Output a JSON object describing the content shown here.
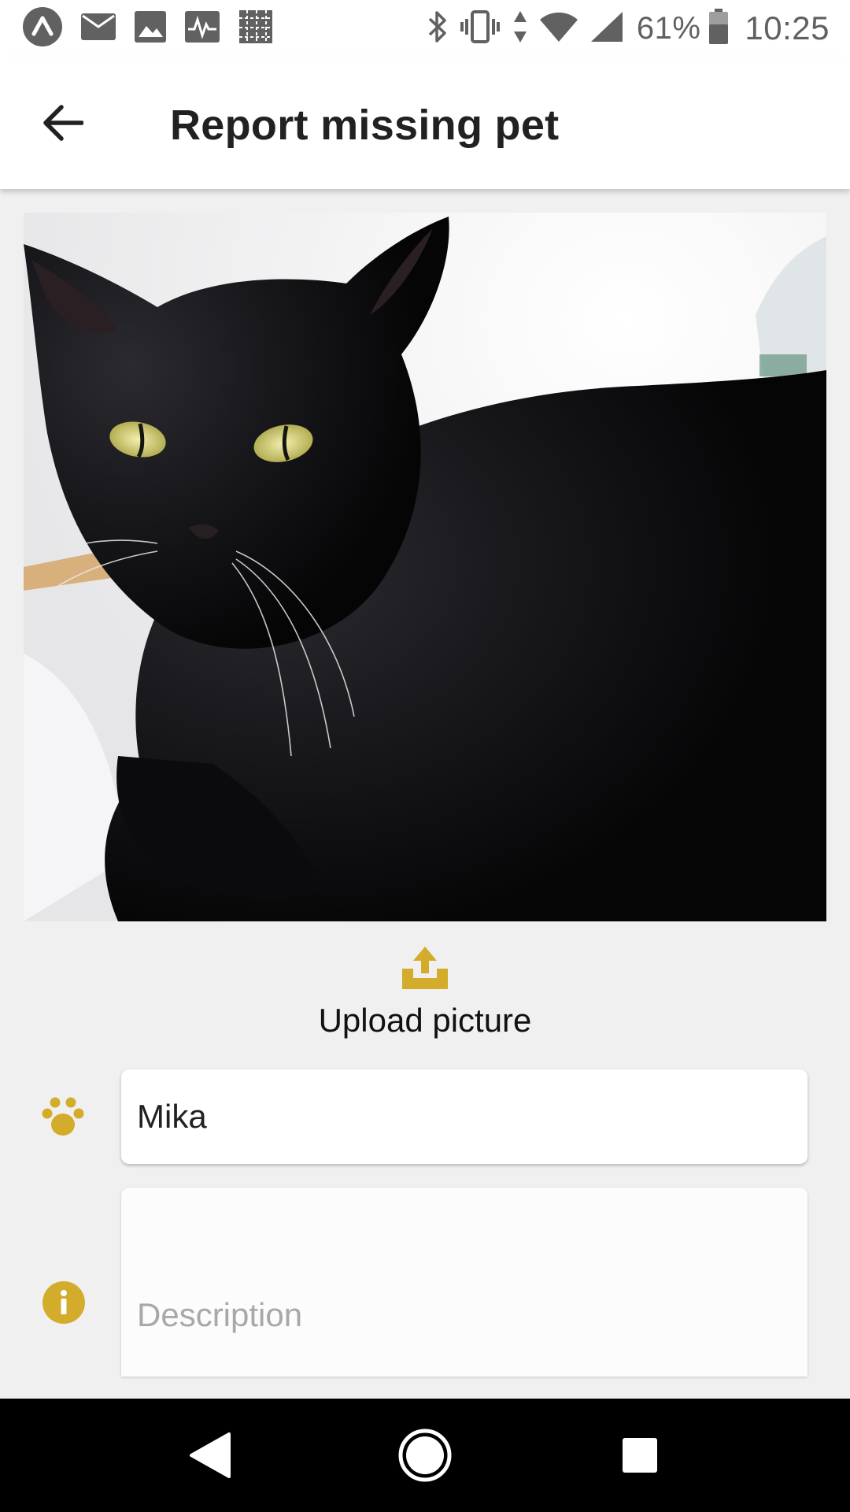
{
  "status_bar": {
    "left_icons": [
      "app-icon",
      "mail-icon",
      "image-icon",
      "pulse-icon",
      "pattern-icon"
    ],
    "right_icons": [
      "bluetooth-icon",
      "vibrate-icon",
      "data-arrows-icon",
      "wifi-icon",
      "signal-icon"
    ],
    "battery_percent": "61%",
    "time": "10:25"
  },
  "app_bar": {
    "back_icon": "arrow-left-icon",
    "title": "Report missing pet"
  },
  "photo": {
    "subject": "black cat"
  },
  "upload": {
    "icon": "upload-icon",
    "label": "Upload picture"
  },
  "form": {
    "name": {
      "icon": "paw-icon",
      "value": "Mika"
    },
    "description": {
      "icon": "info-icon",
      "value": "",
      "placeholder": "Description"
    }
  },
  "nav_bar": {
    "buttons": [
      "back-triangle-icon",
      "home-circle-icon",
      "recents-square-icon"
    ]
  },
  "colors": {
    "accent": "#d4ac2b",
    "background": "#f0f0f0",
    "app_bar": "#ffffff",
    "nav_bar": "#000000"
  }
}
